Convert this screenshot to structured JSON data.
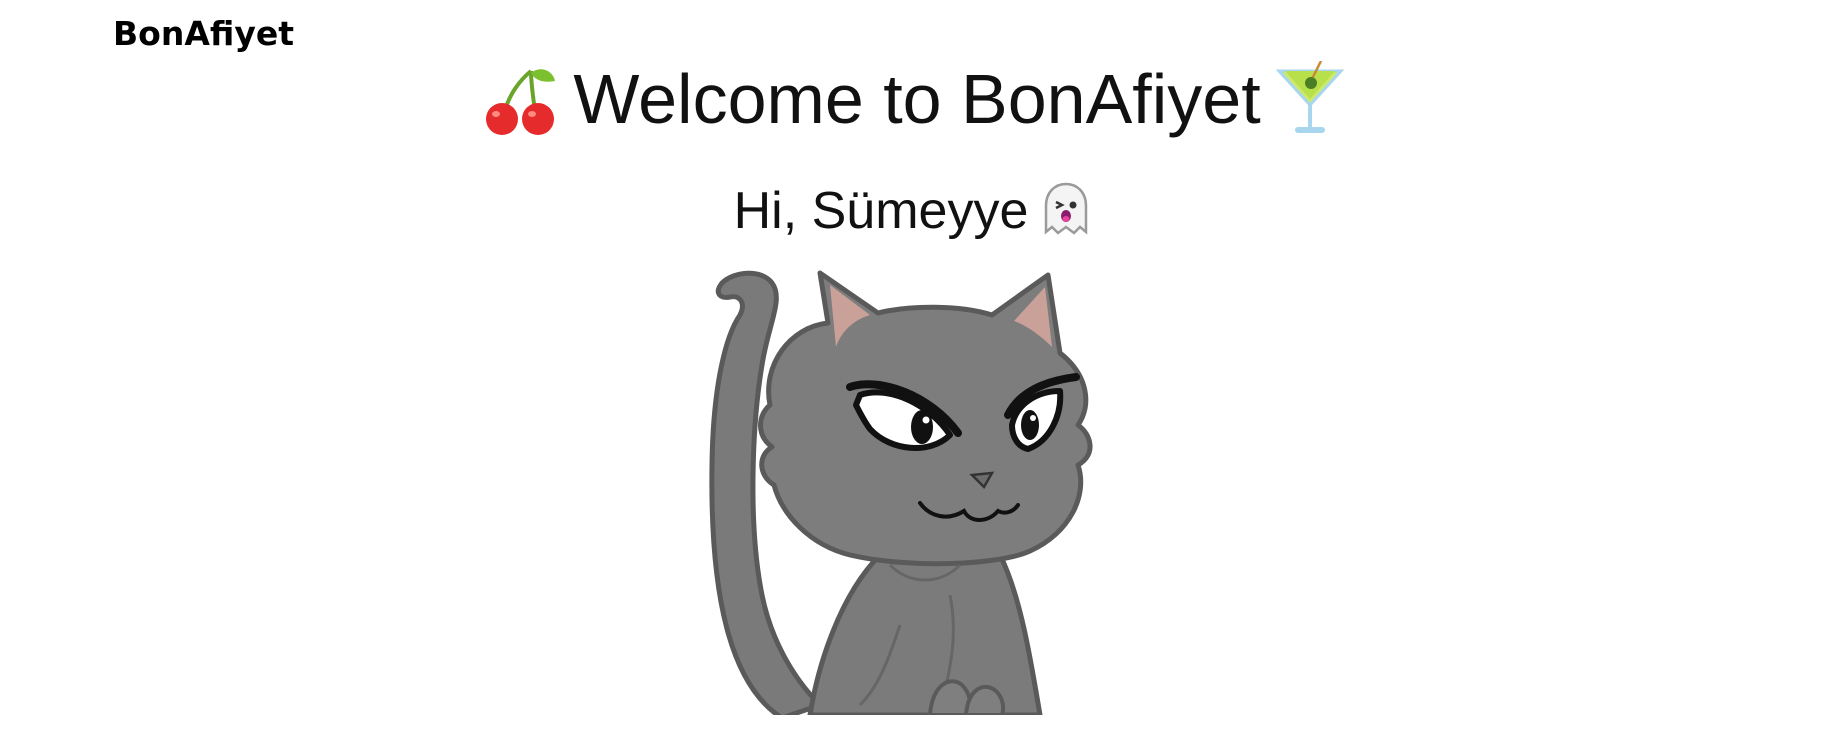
{
  "header": {
    "brand": "BonAfiyet"
  },
  "hero": {
    "title": "Welcome to BonAfiyet",
    "left_icon": "cherries-icon",
    "right_icon": "cocktail-glass-icon"
  },
  "greeting": {
    "text": "Hi, Sümeyye",
    "icon": "ghost-icon"
  },
  "illustration": {
    "subject": "cat-illustration",
    "colors": {
      "fur": "#7a7a7a",
      "outline": "#5a5a5a",
      "ear_inner": "#c9a199"
    }
  }
}
